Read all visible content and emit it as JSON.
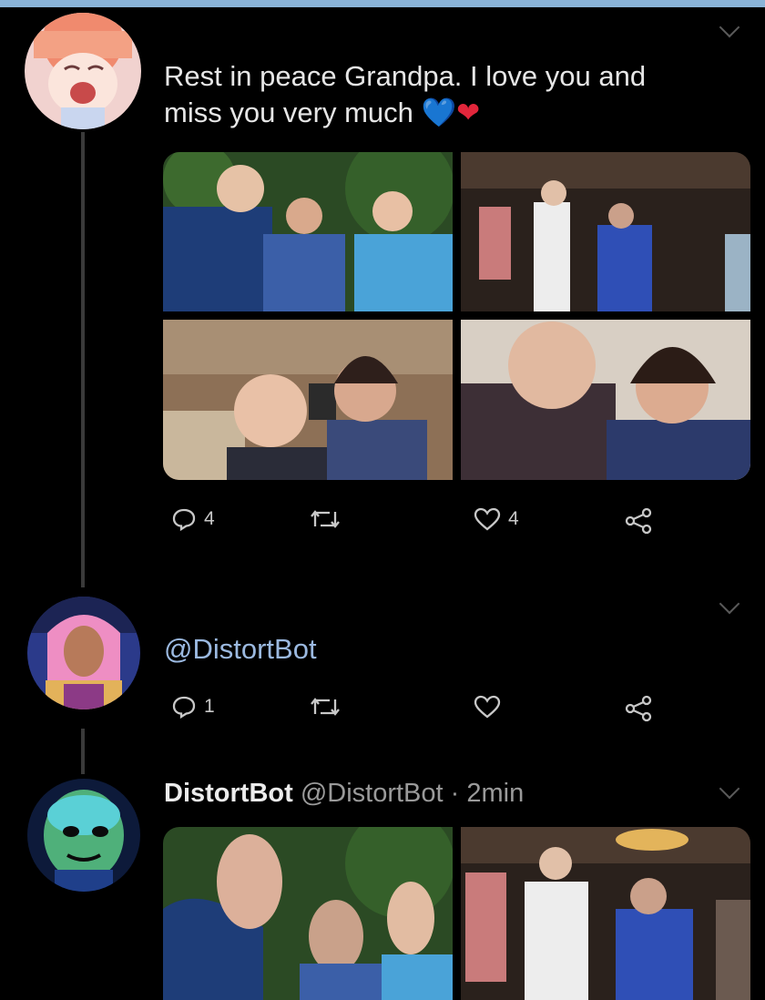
{
  "colors": {
    "background": "#000000",
    "accent": "#9bb9e0",
    "top_strip": "#8ab4d8"
  },
  "tweet1": {
    "text_line1": "Rest in peace Grandpa. I love you and",
    "text_line2": "miss you very much",
    "emoji_blue_heart": "💙",
    "emoji_red_heart": "❤",
    "reply_count": "4",
    "like_count": "4"
  },
  "tweet2": {
    "mention": "@DistortBot",
    "reply_count": "1"
  },
  "tweet3": {
    "display_name": "DistortBot",
    "handle": "@DistortBot",
    "separator": "·",
    "time": "2min"
  },
  "icons": [
    "reply-icon",
    "retweet-icon",
    "like-icon",
    "share-icon",
    "chevron-down-icon"
  ]
}
